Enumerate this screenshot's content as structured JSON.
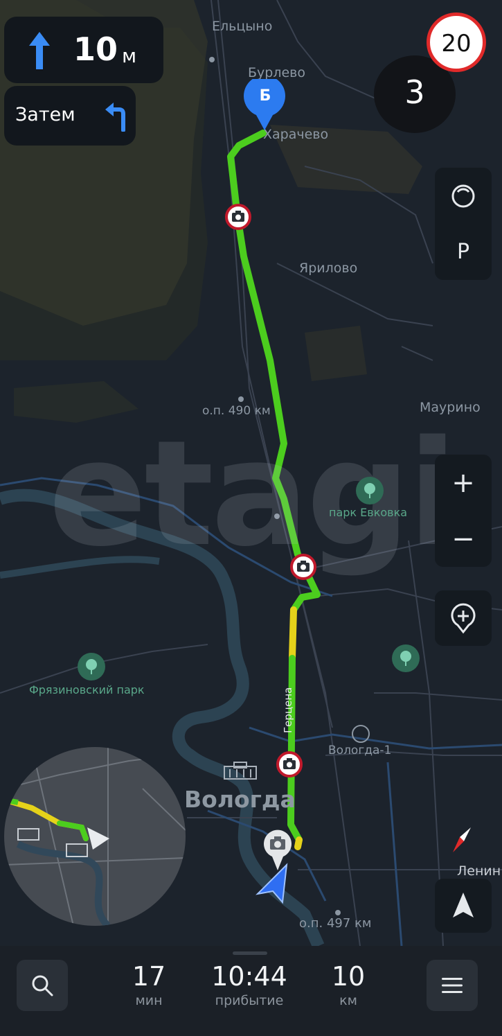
{
  "navigation": {
    "distance_value": "10",
    "distance_unit": "м",
    "then_label": "Затем",
    "speed_limit": "20",
    "current_speed": "3"
  },
  "destination_marker": "Б",
  "places": {
    "elcyno": "Ельцыно",
    "burlevo": "Бурлево",
    "harachevo": "Харачево",
    "yarilovo": "Ярилово",
    "op490": "о.п. 490 км",
    "maurino": "Маурино",
    "park_evkovka": "парк Евковка",
    "fryazinovsky": "Фрязиновский парк",
    "vologda1": "Вологда-1",
    "vologda": "Вологда",
    "lenin": "Ленин",
    "op497": "о.п. 497 км",
    "gertsena": "Герцена"
  },
  "watermark": "etagi",
  "controls": {
    "parking_label": "P",
    "zoom_in": "+",
    "zoom_out": "−"
  },
  "trip": {
    "time_value": "17",
    "time_unit": "мин",
    "arrival_value": "10:44",
    "arrival_label": "прибытие",
    "distance_value": "10",
    "distance_unit": "км"
  },
  "colors": {
    "route_green": "#4ccd1e",
    "route_yellow": "#e5d21a",
    "accent_blue": "#3b82f6",
    "speed_limit_ring": "#e02a2a"
  }
}
